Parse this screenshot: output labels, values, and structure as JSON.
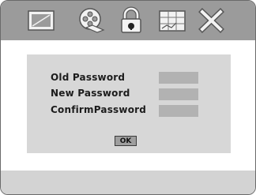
{
  "toolbar": {
    "icons": [
      "monitor-icon",
      "film-reel-icon",
      "lock-icon",
      "grid-tv-icon",
      "close-icon"
    ],
    "active_icon": "lock-icon",
    "background": "#9b9b9b",
    "icon_color": "#f2f2f2"
  },
  "form": {
    "old_password_label": "Old  Password",
    "new_password_label": "New  Password",
    "confirm_password_label": "ConfirmPassword",
    "old_password_value": "",
    "new_password_value": "",
    "confirm_password_value": "",
    "ok_label": "OK"
  },
  "colors": {
    "panel": "#d7d7d7",
    "field": "#b2b2b2",
    "button": "#9e9e9e",
    "status_bar": "#d3d3d3"
  }
}
